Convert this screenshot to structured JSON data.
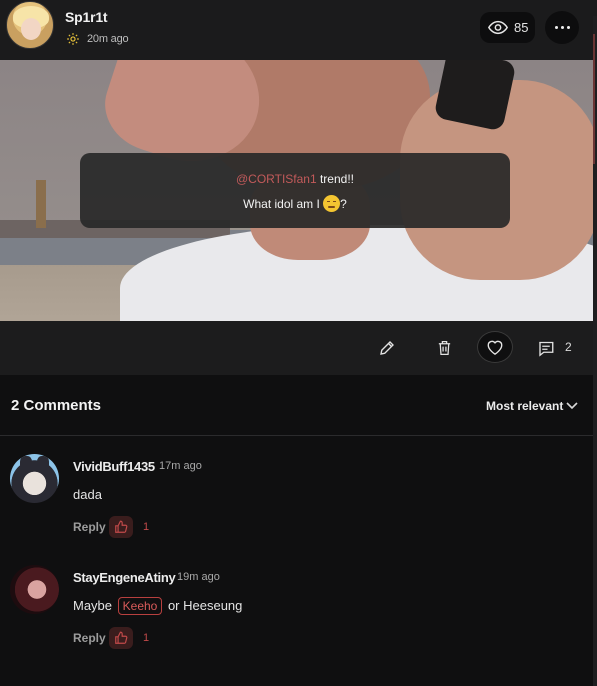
{
  "post": {
    "username": "Sp1r1t",
    "time_ago": "20m ago",
    "views": "85",
    "caption": {
      "mention": "@CORTISfan1",
      "line1_rest": " trend!!",
      "line2_text": "What idol am I ",
      "line2_end": "?"
    },
    "comment_count": "2"
  },
  "comments_section": {
    "title": "2 Comments",
    "sort_label": "Most relevant",
    "items": [
      {
        "username": "VividBuff1435",
        "time_ago": "17m ago",
        "text": "dada",
        "reply_label": "Reply",
        "likes": "1"
      },
      {
        "username": "StayEngeneAtiny",
        "time_ago": "19m ago",
        "text_before": "Maybe ",
        "tag": "Keeho",
        "text_after": " or Heeseung",
        "reply_label": "Reply",
        "likes": "1"
      }
    ]
  },
  "colors": {
    "accent_red": "#c24a4a",
    "gear_yellow": "#e7c23a",
    "background": "#0f0f10",
    "header_bg": "#1b1b1c"
  },
  "icons": [
    "gear-icon",
    "eye-icon",
    "more-icon",
    "edit-icon",
    "trash-icon",
    "heart-icon",
    "comment-icon",
    "chevron-down-icon",
    "thumbs-up-icon"
  ]
}
